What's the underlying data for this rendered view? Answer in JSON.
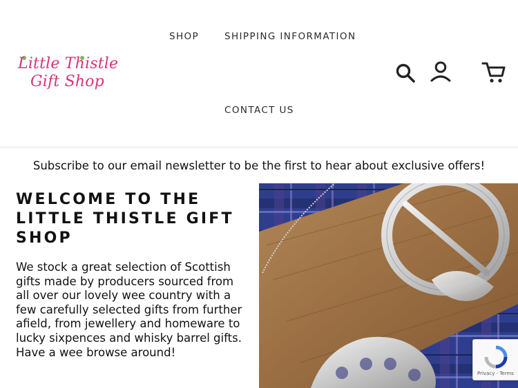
{
  "brand": {
    "line1": "Little Thistle",
    "line2": "Gift Shop"
  },
  "nav": {
    "shop": "SHOP",
    "shipping": "SHIPPING INFORMATION",
    "contact": "CONTACT US"
  },
  "header_icons": [
    "search-icon",
    "account-icon",
    "cart-icon"
  ],
  "banner": {
    "text": "Subscribe to our email newsletter to be the first to hear about exclusive offers!"
  },
  "welcome": {
    "title": "WELCOME TO THE LITTLE THISTLE GIFT SHOP",
    "body": "We stock a great selection of Scottish gifts made by producers sourced from all over our lovely wee country with a few carefully selected gifts from further afield, from jewellery and homeware to lucky sixpences and whisky barrel gifts. Have a wee browse around!"
  },
  "recaptcha": {
    "links": "Privacy - Terms"
  },
  "colors": {
    "brand_pink": "#d6337a",
    "text": "#111111",
    "tartan_blue": "#2f3d8f"
  }
}
